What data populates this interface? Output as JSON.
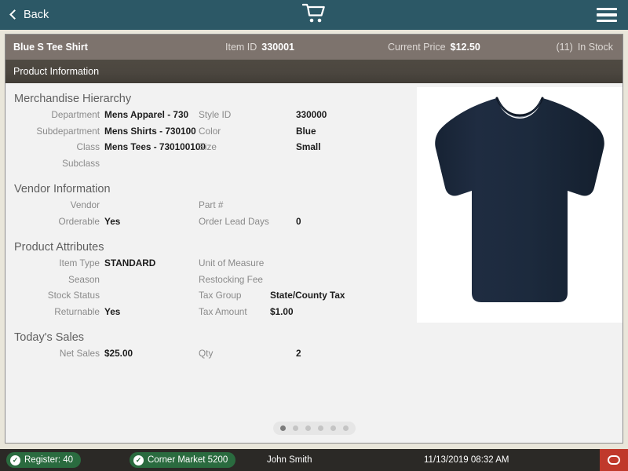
{
  "topbar": {
    "back_label": "Back",
    "back_icon": "chevron-left-icon",
    "cart_icon": "shopping-cart-icon",
    "menu_icon": "hamburger-menu-icon",
    "bg_color": "#2c5866"
  },
  "item_bar": {
    "item_name": "Blue S Tee Shirt",
    "item_id_label": "Item ID",
    "item_id_value": "330001",
    "price_label": "Current Price",
    "price_value": "$12.50",
    "stock_count": "(11)",
    "stock_status": "In Stock",
    "bg_color": "#7d736d"
  },
  "section_bar": {
    "title": "Product Information"
  },
  "sections": [
    {
      "title": "Merchandise Hierarchy",
      "rows": [
        {
          "left_label": "Department",
          "left_value": "Mens Apparel - 730",
          "right_label": "Style ID",
          "right_value": "330000"
        },
        {
          "left_label": "Subdepartment",
          "left_value": "Mens Shirts - 730100",
          "right_label": "Color",
          "right_value": "Blue"
        },
        {
          "left_label": "Class",
          "left_value": "Mens Tees - 730100100",
          "right_label": "Size",
          "right_value": "Small"
        },
        {
          "left_label": "Subclass",
          "left_value": "",
          "right_label": "",
          "right_value": ""
        }
      ]
    },
    {
      "title": "Vendor Information",
      "rows": [
        {
          "left_label": "Vendor",
          "left_value": "",
          "right_label": "Part #",
          "right_value": ""
        },
        {
          "left_label": "Orderable",
          "left_value": "Yes",
          "right_label": "Order Lead Days",
          "right_value": "0"
        }
      ]
    },
    {
      "title": "Product Attributes",
      "rows": [
        {
          "left_label": "Item Type",
          "left_value": "STANDARD",
          "right_label": "Unit of Measure",
          "right_value": ""
        },
        {
          "left_label": "Season",
          "left_value": "",
          "right_label": "Restocking Fee",
          "right_value": ""
        },
        {
          "left_label": "Stock Status",
          "left_value": "",
          "right_label": "Tax Group",
          "right_value": "State/County Tax"
        },
        {
          "left_label": "Returnable",
          "left_value": "Yes",
          "right_label": "Tax Amount",
          "right_value": "$1.00"
        }
      ]
    },
    {
      "title": "Today's Sales",
      "rows": [
        {
          "left_label": "Net Sales",
          "left_value": "$25.00",
          "right_label": "Qty",
          "right_value": "2"
        }
      ]
    }
  ],
  "product_image": {
    "name": "tee-shirt-photo",
    "shirt_color": "#1d2a3e",
    "background": "#ffffff"
  },
  "pager": {
    "total": 6,
    "active_index": 0
  },
  "statusbar": {
    "register_badge": "Register: 40",
    "store_badge": "Corner Market 5200",
    "user": "John Smith",
    "datetime": "11/13/2019 08:32 AM",
    "badge_color": "#2a6b3f",
    "power_color": "#c0392b",
    "power_icon": "power-button-icon"
  }
}
